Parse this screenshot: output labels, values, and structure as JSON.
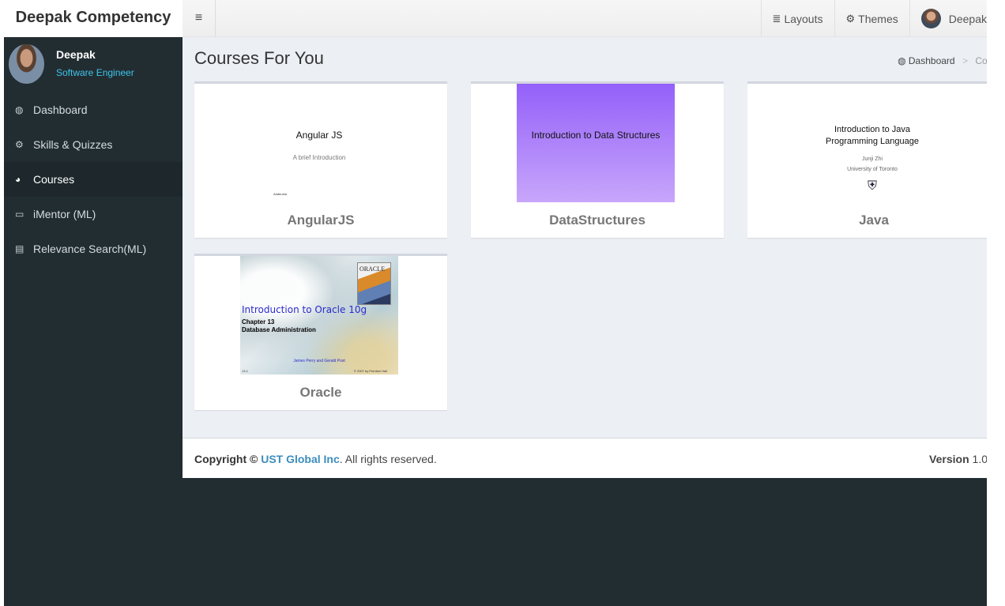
{
  "header": {
    "logo": "Deepak Competency",
    "toggle_icon": "≡",
    "nav": [
      {
        "icon": "≣",
        "label": "Layouts"
      },
      {
        "icon": "⚙",
        "label": "Themes"
      }
    ],
    "user_label": "Deepak"
  },
  "sidebar": {
    "user": {
      "name": "Deepak",
      "role": "Software Engineer"
    },
    "items": [
      {
        "icon": "◍",
        "label": "Dashboard"
      },
      {
        "icon": "⚙",
        "label": "Skills & Quizzes"
      },
      {
        "icon": "◕",
        "label": "Courses",
        "active": true
      },
      {
        "icon": "▭",
        "label": "iMentor (ML)"
      },
      {
        "icon": "▤",
        "label": "Relevance Search(ML)"
      }
    ]
  },
  "main": {
    "title": "Courses For You",
    "breadcrumb": {
      "icon": "◍",
      "home": "Dashboard",
      "sep": ">",
      "current": "Courses"
    },
    "courses": [
      {
        "title": "AngularJS",
        "thumb": {
          "line1": "Angular JS",
          "line2": "A brief Introduction",
          "line3": "Adabuela"
        }
      },
      {
        "title": "DataStructures",
        "thumb": {
          "line1": "Introduction to Data Structures"
        }
      },
      {
        "title": "Java",
        "thumb": {
          "line1": "Introduction to Java",
          "line1b": "Programming Language",
          "line2": "Junji Zhi",
          "line3": "University of Toronto"
        }
      },
      {
        "title": "Oracle",
        "thumb": {
          "book": "ORACLE",
          "line1": "Introduction to Oracle 10g",
          "line2": "Chapter 13",
          "line2b": "Database Administration",
          "line3": "James Perry and Gerald Post",
          "line4": "13-1",
          "line5": "© 2007 by Prentice Hall"
        }
      }
    ]
  },
  "footer": {
    "copyright_prefix": "Copyright ©",
    "company": "UST Global Inc",
    "suffix": ". All rights reserved.",
    "version_label": "Version",
    "version_value": "1.0"
  },
  "colors": {
    "sidebar_bg": "#222d32",
    "content_bg": "#ecf0f5",
    "accent_link": "#3c8dbc",
    "user_role": "#3ec4ea"
  }
}
